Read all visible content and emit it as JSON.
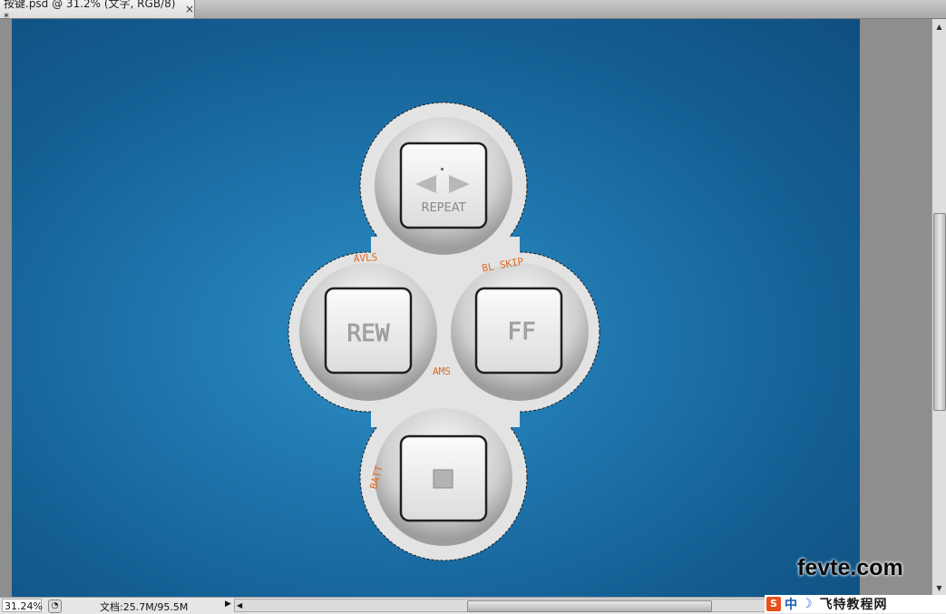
{
  "tab": {
    "title": "按键.psd @ 31.2% (文字, RGB/8) *",
    "close": "×"
  },
  "status": {
    "zoom": "31.24%",
    "doc": "文档:25.7M/95.5M"
  },
  "buttons": {
    "repeat": "REPEAT",
    "rew": "REW",
    "ff": "FF"
  },
  "labels": {
    "avls": "AVLS",
    "blskip": "BL SKIP",
    "ams": "AMS",
    "batt": "BATT"
  },
  "ime": {
    "s": "S",
    "zh": "中",
    "brand": "飞特教程网"
  },
  "watermark": "fevte.com",
  "colors": {
    "background": "#1f76ad",
    "label": "#e06a1f",
    "bezel": "#d8d8d8"
  }
}
